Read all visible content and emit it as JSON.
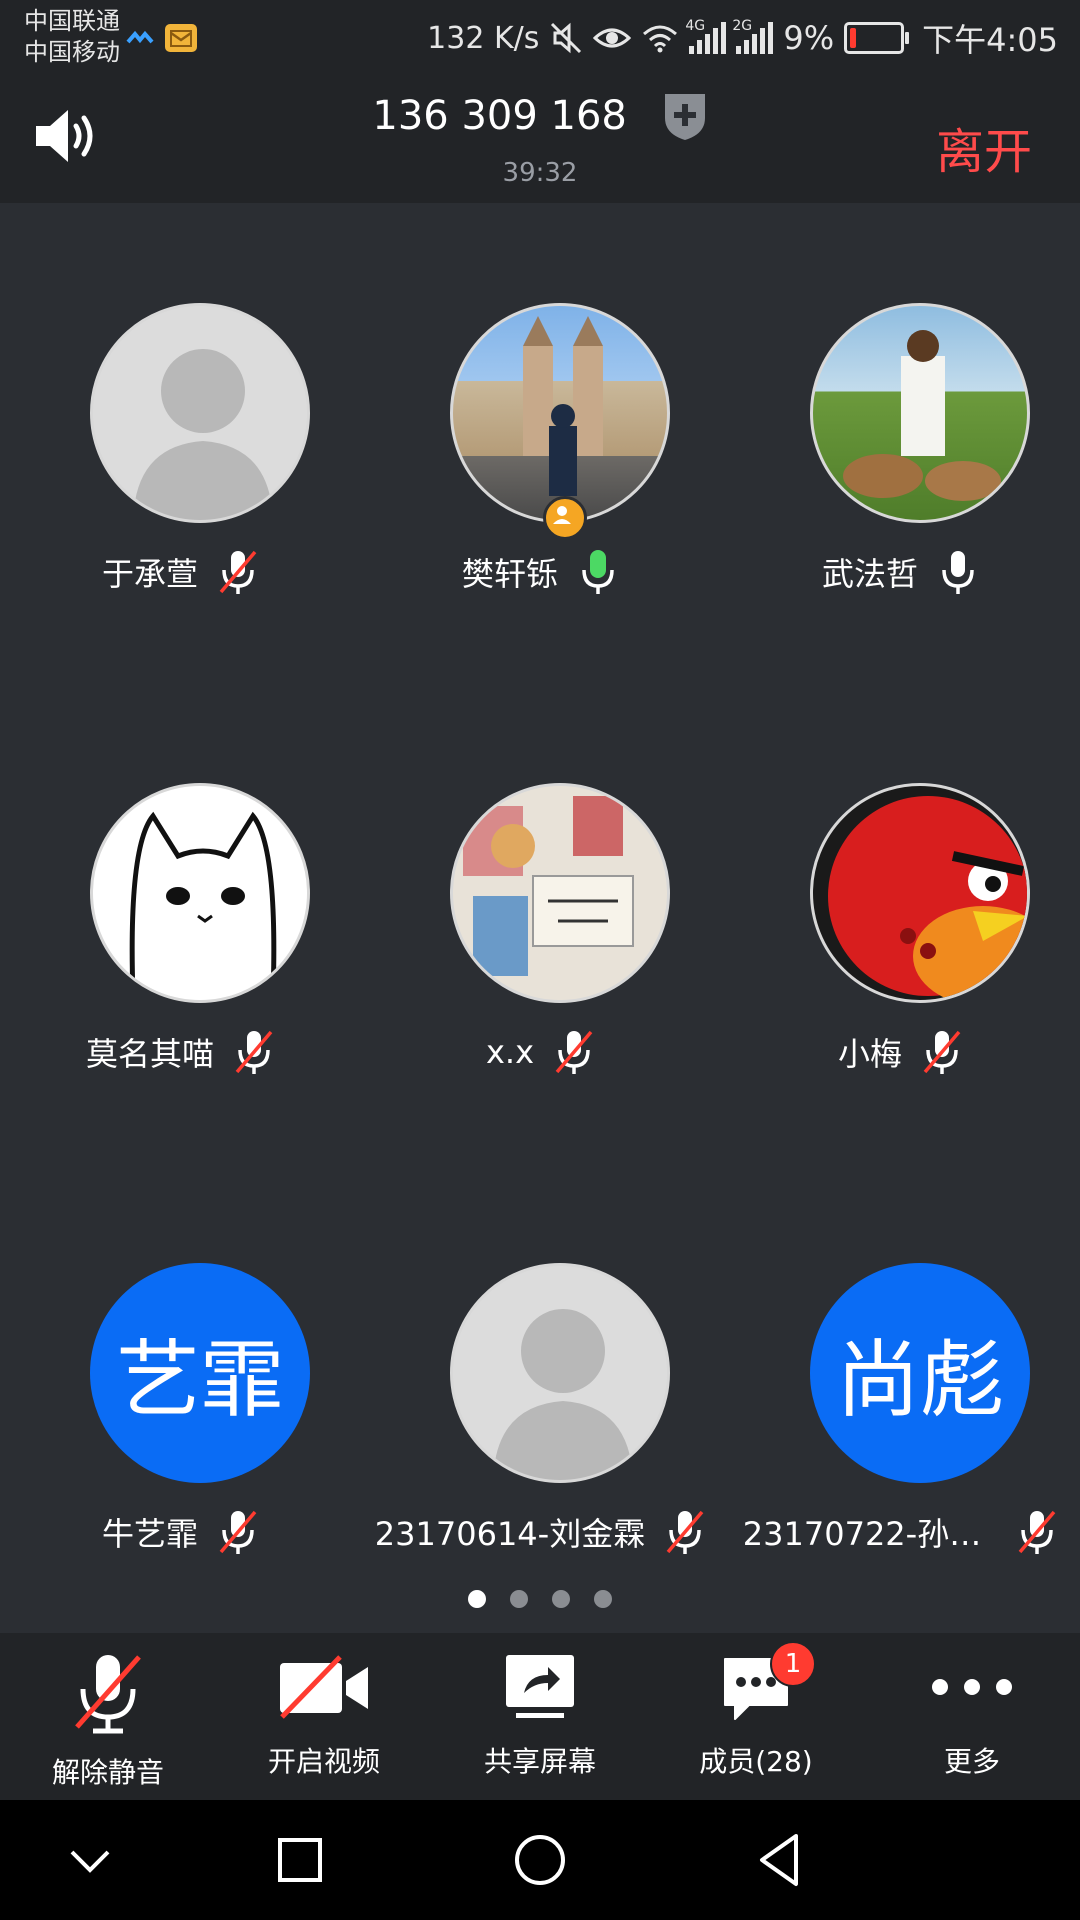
{
  "status_bar": {
    "carrier_1": "中国联通",
    "carrier_2": "中国移动",
    "speed": "132 K/s",
    "net_1": "4G",
    "net_2": "2G",
    "battery": "9%",
    "time": "下午4:05",
    "icons": [
      "hd-icon",
      "mail-icon",
      "mute-icon",
      "eye-icon",
      "wifi-icon",
      "signal-icon",
      "signal-icon",
      "battery-icon"
    ]
  },
  "header": {
    "meeting_id": "136 309 168",
    "duration": "39:32",
    "leave_label": "离开",
    "leave_color": "#ff4b4b"
  },
  "participants": [
    {
      "name": "于承萱",
      "avatar": "default-avatar",
      "mic": "muted"
    },
    {
      "name": "樊轩铄",
      "avatar": "photo-church",
      "mic": "speaking",
      "host": true
    },
    {
      "name": "武法哲",
      "avatar": "photo-deer",
      "mic": "on"
    },
    {
      "name": "莫名其喵",
      "avatar": "photo-cat",
      "mic": "muted"
    },
    {
      "name": "x.x",
      "avatar": "photo-stickers",
      "mic": "muted"
    },
    {
      "name": "小梅",
      "avatar": "photo-angry-bird",
      "mic": "muted"
    },
    {
      "name": "牛艺霏",
      "avatar": "initials",
      "initials": "艺霏",
      "mic": "muted"
    },
    {
      "name": "23170614-刘金霖",
      "avatar": "default-avatar",
      "mic": "muted"
    },
    {
      "name": "23170722-孙…",
      "avatar": "initials",
      "initials": "尚彪",
      "mic": "muted"
    }
  ],
  "pager": {
    "pages": 4,
    "current": 1
  },
  "toolbar": {
    "unmute_label": "解除静音",
    "video_label": "开启视频",
    "share_label": "共享屏幕",
    "members_label": "成员(28)",
    "members_badge": "1",
    "more_label": "更多"
  },
  "colors": {
    "background": "#2b2e33",
    "bar": "#222427",
    "accent_blue": "#0a6cf5",
    "speaking_green": "#4cd964",
    "muted_red": "#ff3b30"
  }
}
